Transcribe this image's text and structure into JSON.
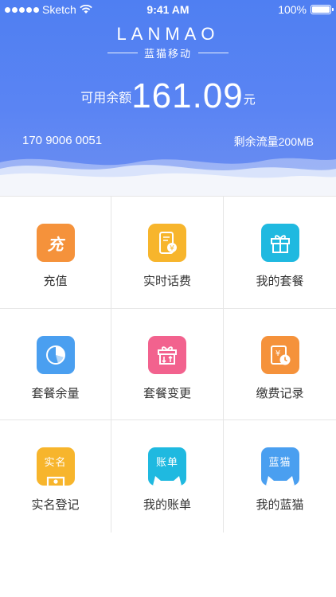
{
  "status_bar": {
    "carrier": "Sketch",
    "time": "9:41 AM",
    "battery": "100%"
  },
  "header": {
    "logo_text": "LANMAO",
    "logo_subtitle": "蓝猫移动",
    "balance_label": "可用余额",
    "balance_amount": "161.09",
    "balance_unit": "元",
    "phone_number": "170 9006 0051",
    "traffic_label": "剩余流量",
    "traffic_value": "200MB"
  },
  "menu": {
    "items": [
      {
        "label": "充值",
        "icon": "recharge-icon",
        "glyph": "充",
        "color": "#f5923b"
      },
      {
        "label": "实时话费",
        "icon": "phone-bill-icon",
        "color": "#f7b52c"
      },
      {
        "label": "我的套餐",
        "icon": "gift-box-icon",
        "color": "#1fb9e0"
      },
      {
        "label": "套餐余量",
        "icon": "pie-chart-icon",
        "color": "#4a9ff0"
      },
      {
        "label": "套餐变更",
        "icon": "package-change-icon",
        "color": "#f2628e"
      },
      {
        "label": "缴费记录",
        "icon": "payment-record-icon",
        "color": "#f5923b"
      },
      {
        "label": "实名登记",
        "icon": "real-name-icon",
        "glyph": "实名",
        "color": "#f7b52c"
      },
      {
        "label": "我的账单",
        "icon": "bill-cat-icon",
        "glyph": "账单",
        "color": "#1fb9e0"
      },
      {
        "label": "我的蓝猫",
        "icon": "lanmao-cat-icon",
        "glyph": "蓝猫",
        "color": "#4a9ff0"
      }
    ]
  }
}
